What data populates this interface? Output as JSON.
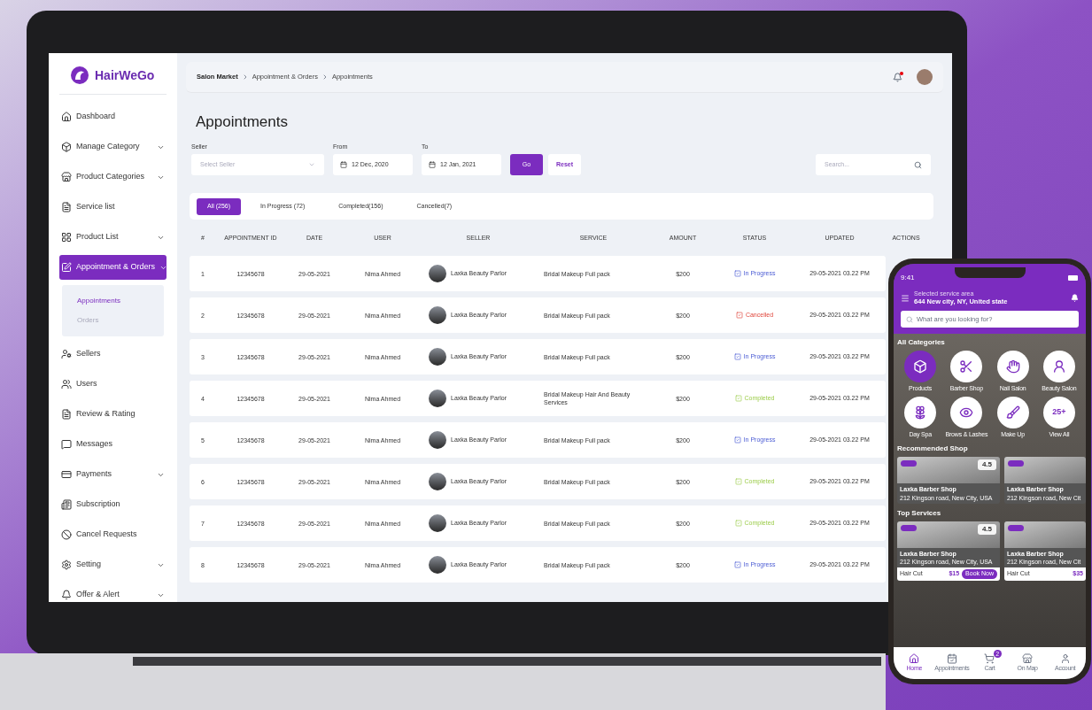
{
  "brand": "HairWeGo",
  "sidebar": {
    "items": [
      {
        "label": "Dashboard",
        "chevron": false,
        "selected": false
      },
      {
        "label": "Manage Category",
        "chevron": true,
        "selected": false
      },
      {
        "label": "Product Categories",
        "chevron": true,
        "selected": false
      },
      {
        "label": "Service list",
        "chevron": false,
        "selected": false
      },
      {
        "label": "Product List",
        "chevron": true,
        "selected": false
      },
      {
        "label": "Appointment & Orders",
        "chevron": true,
        "selected": true,
        "children": [
          {
            "label": "Appointments",
            "selected": true
          },
          {
            "label": "Orders",
            "selected": false
          }
        ]
      },
      {
        "label": "Sellers",
        "chevron": false,
        "selected": false
      },
      {
        "label": "Users",
        "chevron": false,
        "selected": false
      },
      {
        "label": "Review & Rating",
        "chevron": false,
        "selected": false
      },
      {
        "label": "Messages",
        "chevron": false,
        "selected": false
      },
      {
        "label": "Payments",
        "chevron": true,
        "selected": false
      },
      {
        "label": "Subscription",
        "chevron": false,
        "selected": false
      },
      {
        "label": "Cancel Requests",
        "chevron": false,
        "selected": false
      },
      {
        "label": "Setting",
        "chevron": true,
        "selected": false
      },
      {
        "label": "Offer & Alert",
        "chevron": true,
        "selected": false
      }
    ]
  },
  "breadcrumb": [
    "Salon Market",
    "Appointment & Orders",
    "Appointments"
  ],
  "header": {
    "notification": true
  },
  "page_title": "Appointments",
  "filters": {
    "seller_label": "Seller",
    "seller_placeholder": "Select Seller",
    "from_label": "From",
    "from_value": "12 Dec, 2020",
    "to_label": "To",
    "to_value": "12 Jan, 2021",
    "go": "Go",
    "reset": "Reset",
    "search_placeholder": "Search..."
  },
  "tabs": [
    {
      "label": "All (256)",
      "selected": true
    },
    {
      "label": "In Progress (72)",
      "selected": false
    },
    {
      "label": "Completed(156)",
      "selected": false
    },
    {
      "label": "Cancelled(7)",
      "selected": false
    }
  ],
  "table": {
    "columns": [
      "#",
      "APPOINTMENT ID",
      "DATE",
      "USER",
      "SELLER",
      "SERVICE",
      "AMOUNT",
      "STATUS",
      "UPDATED",
      "ACTIONS"
    ],
    "rows": [
      {
        "cells": [
          "1",
          "12345678",
          "29-05-2021",
          "Nima Ahmed",
          "Laxka Beauty Parlor",
          "Bridal Makeup Full pack",
          "$200",
          "29-05-2021 03.22 PM"
        ],
        "status": {
          "label": "In Progress",
          "kind": "progress"
        }
      },
      {
        "cells": [
          "2",
          "12345678",
          "29-05-2021",
          "Nima Ahmed",
          "Laxka Beauty Parlor",
          "Bridal Makeup Full pack",
          "$200",
          "29-05-2021 03.22 PM"
        ],
        "status": {
          "label": "Cancelled",
          "kind": "cancelled"
        }
      },
      {
        "cells": [
          "3",
          "12345678",
          "29-05-2021",
          "Nima Ahmed",
          "Laxka Beauty Parlor",
          "Bridal Makeup Full pack",
          "$200",
          "29-05-2021 03.22 PM"
        ],
        "status": {
          "label": "In Progress",
          "kind": "progress"
        }
      },
      {
        "cells": [
          "4",
          "12345678",
          "29-05-2021",
          "Nima Ahmed",
          "Laxka Beauty Parlor",
          "Bridal Makeup Hair And Beauty Services",
          "$200",
          "29-05-2021 03.22 PM"
        ],
        "status": {
          "label": "Completed",
          "kind": "completed"
        }
      },
      {
        "cells": [
          "5",
          "12345678",
          "29-05-2021",
          "Nima Ahmed",
          "Laxka Beauty Parlor",
          "Bridal Makeup Full pack",
          "$200",
          "29-05-2021 03.22 PM"
        ],
        "status": {
          "label": "In Progress",
          "kind": "progress"
        }
      },
      {
        "cells": [
          "6",
          "12345678",
          "29-05-2021",
          "Nima Ahmed",
          "Laxka Beauty Parlor",
          "Bridal Makeup Full pack",
          "$200",
          "29-05-2021 03.22 PM"
        ],
        "status": {
          "label": "Completed",
          "kind": "completed"
        }
      },
      {
        "cells": [
          "7",
          "12345678",
          "29-05-2021",
          "Nima Ahmed",
          "Laxka Beauty Parlor",
          "Bridal Makeup Full pack",
          "$200",
          "29-05-2021 03.22 PM"
        ],
        "status": {
          "label": "Completed",
          "kind": "completed"
        }
      },
      {
        "cells": [
          "8",
          "12345678",
          "29-05-2021",
          "Nima Ahmed",
          "Laxka Beauty Parlor",
          "Bridal Makeup Full pack",
          "$200",
          "29-05-2021 03.22 PM"
        ],
        "status": {
          "label": "In Progress",
          "kind": "progress"
        }
      }
    ]
  },
  "phone": {
    "time": "9:41",
    "area_label": "Selected service area",
    "area": "644 New city, NY, United state",
    "search_placeholder": "What are you looking for?",
    "categories_title": "All Categories",
    "categories": [
      {
        "label": "Products",
        "selected": true
      },
      {
        "label": "Barber Shop",
        "selected": false
      },
      {
        "label": "Nail Salon",
        "selected": false
      },
      {
        "label": "Beauty Salon",
        "selected": false
      },
      {
        "label": "Day Spa",
        "selected": false
      },
      {
        "label": "Brows & Lashes",
        "selected": false
      },
      {
        "label": "Make Up",
        "selected": false
      },
      {
        "label": "View All",
        "badge": "25+",
        "selected": false
      }
    ],
    "recommended_title": "Recommended Shop",
    "recommended": [
      {
        "name": "Laxka Barber Shop",
        "address": "212 Kingson road, New City, USA",
        "rating": "4.5"
      },
      {
        "name": "Laxka Barber Shop",
        "address": "212 Kingson road, New Cit"
      }
    ],
    "services_title": "Top Services",
    "services": [
      {
        "name": "Laxka Barber Shop",
        "address": "212 Kingson road, New City, USA",
        "rating": "4.5",
        "service": "Hair Cut",
        "price": "$15",
        "button": "Book Now"
      },
      {
        "name": "Laxka Barber Shop",
        "address": "212 Kingson road, New Cit",
        "service": "Hair Cut",
        "price": "$35"
      }
    ],
    "nav": [
      {
        "label": "Home",
        "selected": true
      },
      {
        "label": "Appointments",
        "selected": false
      },
      {
        "label": "Cart",
        "selected": false,
        "badge": "2"
      },
      {
        "label": "On Map",
        "selected": false
      },
      {
        "label": "Account",
        "selected": false
      }
    ]
  }
}
